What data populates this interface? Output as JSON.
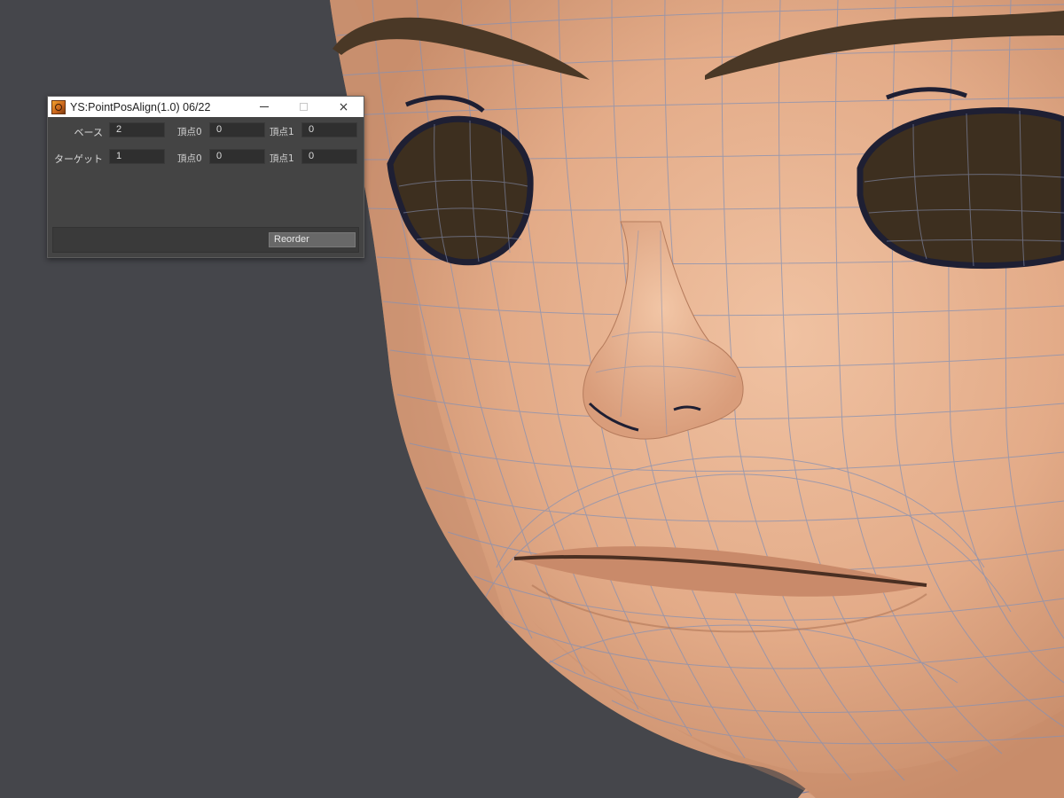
{
  "window": {
    "title": "YS:PointPosAlign(1.0) 06/22",
    "icon": "plugin-app-icon",
    "controls": {
      "minimize": "minimize-icon",
      "maximize": "maximize-icon",
      "close": "×"
    }
  },
  "rows": [
    {
      "label": "ベース",
      "value": "2",
      "vertex0_label": "頂点0",
      "vertex0_value": "0",
      "vertex1_label": "頂点1",
      "vertex1_value": "0"
    },
    {
      "label": "ターゲット",
      "value": "1",
      "vertex0_label": "頂点0",
      "vertex0_value": "0",
      "vertex1_label": "頂点1",
      "vertex1_value": "0"
    }
  ],
  "actions": {
    "reorder_label": "Reorder"
  },
  "colors": {
    "viewport_bg": "#45464b",
    "skin": "#e6b08e",
    "wireframe": "#7f8aa8",
    "eye_dark": "#3d2f1f",
    "brow": "#4a3826"
  }
}
